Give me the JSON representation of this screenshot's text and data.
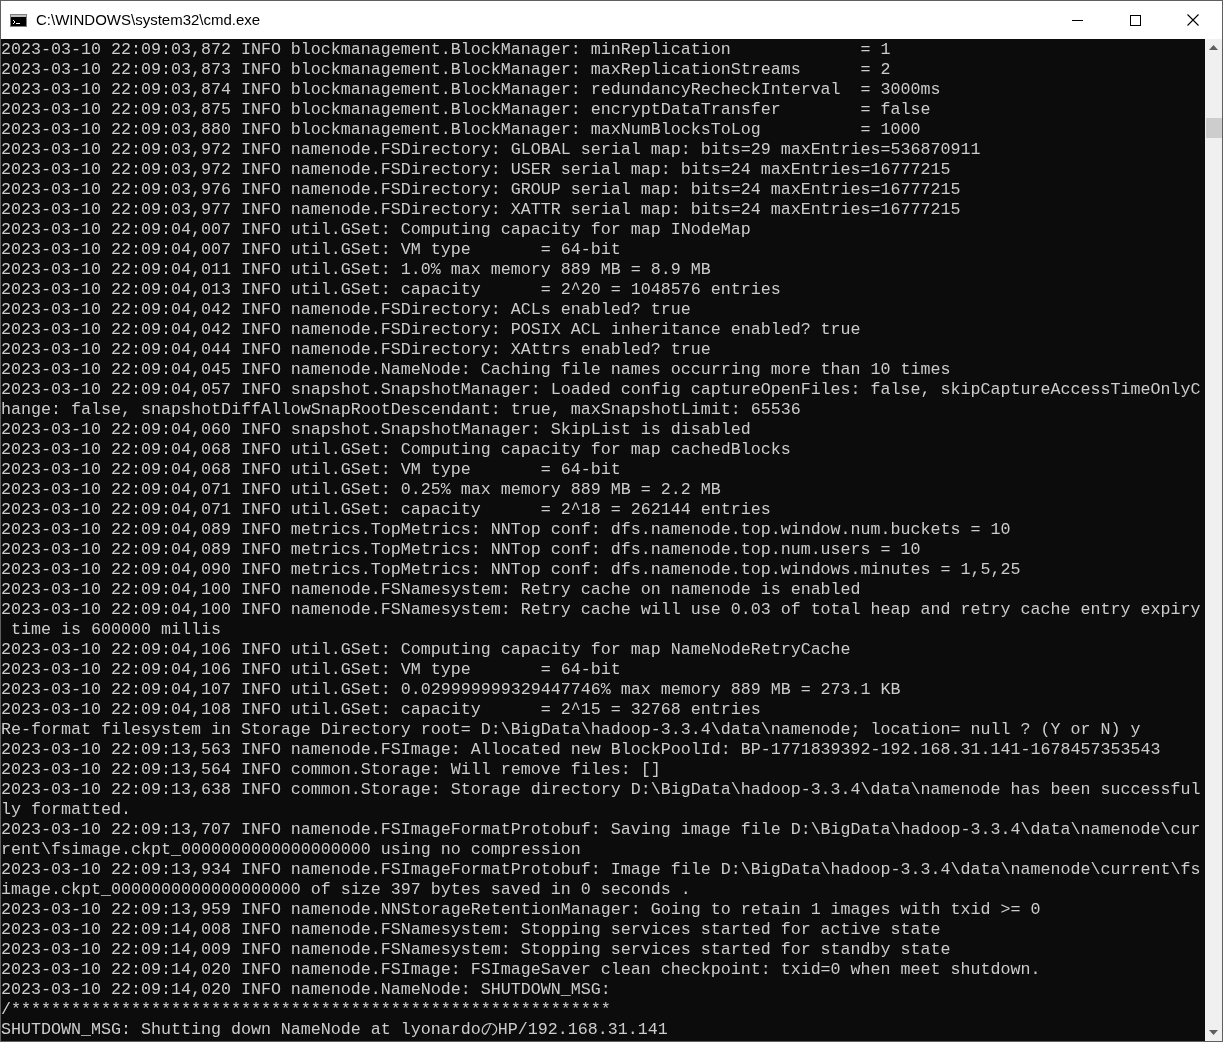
{
  "window": {
    "title": "C:\\WINDOWS\\system32\\cmd.exe"
  },
  "console_lines": [
    "2023-03-10 22:09:03,872 INFO blockmanagement.BlockManager: minReplication             = 1",
    "2023-03-10 22:09:03,873 INFO blockmanagement.BlockManager: maxReplicationStreams      = 2",
    "2023-03-10 22:09:03,874 INFO blockmanagement.BlockManager: redundancyRecheckInterval  = 3000ms",
    "2023-03-10 22:09:03,875 INFO blockmanagement.BlockManager: encryptDataTransfer        = false",
    "2023-03-10 22:09:03,880 INFO blockmanagement.BlockManager: maxNumBlocksToLog          = 1000",
    "2023-03-10 22:09:03,972 INFO namenode.FSDirectory: GLOBAL serial map: bits=29 maxEntries=536870911",
    "2023-03-10 22:09:03,972 INFO namenode.FSDirectory: USER serial map: bits=24 maxEntries=16777215",
    "2023-03-10 22:09:03,976 INFO namenode.FSDirectory: GROUP serial map: bits=24 maxEntries=16777215",
    "2023-03-10 22:09:03,977 INFO namenode.FSDirectory: XATTR serial map: bits=24 maxEntries=16777215",
    "2023-03-10 22:09:04,007 INFO util.GSet: Computing capacity for map INodeMap",
    "2023-03-10 22:09:04,007 INFO util.GSet: VM type       = 64-bit",
    "2023-03-10 22:09:04,011 INFO util.GSet: 1.0% max memory 889 MB = 8.9 MB",
    "2023-03-10 22:09:04,013 INFO util.GSet: capacity      = 2^20 = 1048576 entries",
    "2023-03-10 22:09:04,042 INFO namenode.FSDirectory: ACLs enabled? true",
    "2023-03-10 22:09:04,042 INFO namenode.FSDirectory: POSIX ACL inheritance enabled? true",
    "2023-03-10 22:09:04,044 INFO namenode.FSDirectory: XAttrs enabled? true",
    "2023-03-10 22:09:04,045 INFO namenode.NameNode: Caching file names occurring more than 10 times",
    "2023-03-10 22:09:04,057 INFO snapshot.SnapshotManager: Loaded config captureOpenFiles: false, skipCaptureAccessTimeOnlyC",
    "hange: false, snapshotDiffAllowSnapRootDescendant: true, maxSnapshotLimit: 65536",
    "2023-03-10 22:09:04,060 INFO snapshot.SnapshotManager: SkipList is disabled",
    "2023-03-10 22:09:04,068 INFO util.GSet: Computing capacity for map cachedBlocks",
    "2023-03-10 22:09:04,068 INFO util.GSet: VM type       = 64-bit",
    "2023-03-10 22:09:04,071 INFO util.GSet: 0.25% max memory 889 MB = 2.2 MB",
    "2023-03-10 22:09:04,071 INFO util.GSet: capacity      = 2^18 = 262144 entries",
    "2023-03-10 22:09:04,089 INFO metrics.TopMetrics: NNTop conf: dfs.namenode.top.window.num.buckets = 10",
    "2023-03-10 22:09:04,089 INFO metrics.TopMetrics: NNTop conf: dfs.namenode.top.num.users = 10",
    "2023-03-10 22:09:04,090 INFO metrics.TopMetrics: NNTop conf: dfs.namenode.top.windows.minutes = 1,5,25",
    "2023-03-10 22:09:04,100 INFO namenode.FSNamesystem: Retry cache on namenode is enabled",
    "2023-03-10 22:09:04,100 INFO namenode.FSNamesystem: Retry cache will use 0.03 of total heap and retry cache entry expiry",
    " time is 600000 millis",
    "2023-03-10 22:09:04,106 INFO util.GSet: Computing capacity for map NameNodeRetryCache",
    "2023-03-10 22:09:04,106 INFO util.GSet: VM type       = 64-bit",
    "2023-03-10 22:09:04,107 INFO util.GSet: 0.029999999329447746% max memory 889 MB = 273.1 KB",
    "2023-03-10 22:09:04,108 INFO util.GSet: capacity      = 2^15 = 32768 entries",
    "Re-format filesystem in Storage Directory root= D:\\BigData\\hadoop-3.3.4\\data\\namenode; location= null ? (Y or N) y",
    "2023-03-10 22:09:13,563 INFO namenode.FSImage: Allocated new BlockPoolId: BP-1771839392-192.168.31.141-1678457353543",
    "2023-03-10 22:09:13,564 INFO common.Storage: Will remove files: []",
    "2023-03-10 22:09:13,638 INFO common.Storage: Storage directory D:\\BigData\\hadoop-3.3.4\\data\\namenode has been successful",
    "ly formatted.",
    "2023-03-10 22:09:13,707 INFO namenode.FSImageFormatProtobuf: Saving image file D:\\BigData\\hadoop-3.3.4\\data\\namenode\\cur",
    "rent\\fsimage.ckpt_0000000000000000000 using no compression",
    "2023-03-10 22:09:13,934 INFO namenode.FSImageFormatProtobuf: Image file D:\\BigData\\hadoop-3.3.4\\data\\namenode\\current\\fs",
    "image.ckpt_0000000000000000000 of size 397 bytes saved in 0 seconds .",
    "2023-03-10 22:09:13,959 INFO namenode.NNStorageRetentionManager: Going to retain 1 images with txid >= 0",
    "2023-03-10 22:09:14,008 INFO namenode.FSNamesystem: Stopping services started for active state",
    "2023-03-10 22:09:14,009 INFO namenode.FSNamesystem: Stopping services started for standby state",
    "2023-03-10 22:09:14,020 INFO namenode.FSImage: FSImageSaver clean checkpoint: txid=0 when meet shutdown.",
    "2023-03-10 22:09:14,020 INFO namenode.NameNode: SHUTDOWN_MSG:",
    "/************************************************************",
    "SHUTDOWN_MSG: Shutting down NameNode at lyonardoのHP/192.168.31.141"
  ]
}
